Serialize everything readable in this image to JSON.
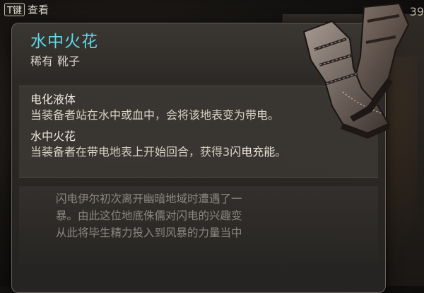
{
  "hint": {
    "key": "T键",
    "label": "查看"
  },
  "counter": "39",
  "item": {
    "name": "水中火花",
    "rarity": "稀有",
    "type": "靴子",
    "name_color": "#5fd8e8"
  },
  "abilities": [
    {
      "name": "电化液体",
      "desc": "当装备者站在水中或血中，会将该地表变为带电。"
    },
    {
      "name": "水中火花",
      "desc_pre": "当装备者在带电地表上开始回合，获得3",
      "desc_hl": "闪电充能",
      "desc_post": "。"
    }
  ],
  "flavor": [
    "闪电伊尔初次离开幽暗地域时遭遇了一",
    "暴。由此这位地底侏儒对闪电的兴趣变",
    "从此将毕生精力投入到风暴的力量当中"
  ],
  "icons": {
    "item_art": "boots-icon"
  }
}
